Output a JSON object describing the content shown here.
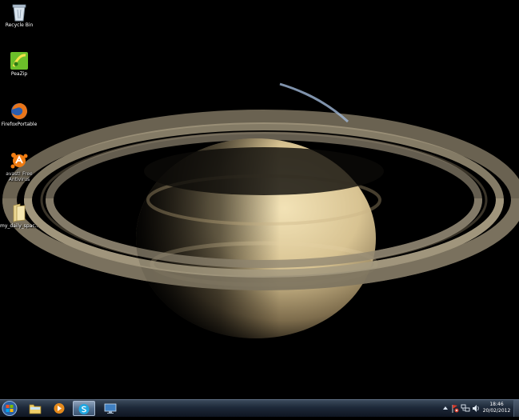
{
  "desktop": {
    "icons": [
      {
        "label": "Recycle Bin",
        "icon": "recycle-bin-icon"
      },
      {
        "label": "PeaZip",
        "icon": "peazip-icon"
      },
      {
        "label": "FirefoxPortable",
        "icon": "firefox-icon"
      },
      {
        "label": "avast! Free Antivirus",
        "icon": "avast-icon"
      },
      {
        "label": "my_daily_spac...",
        "icon": "folder-icon"
      }
    ],
    "wallpaper": "saturn-wallpaper"
  },
  "taskbar": {
    "pinned": [
      {
        "name": "windows-explorer",
        "icon": "folder-icon"
      },
      {
        "name": "media-player",
        "icon": "media-player-icon"
      },
      {
        "name": "skype",
        "icon": "skype-icon",
        "active": true
      },
      {
        "name": "remote-desktop",
        "icon": "monitor-icon"
      }
    ],
    "clock": {
      "time": "18:46",
      "date": "20/02/2012"
    }
  },
  "colors": {
    "taskbar": "#1d2838",
    "desktop": "#000000"
  }
}
